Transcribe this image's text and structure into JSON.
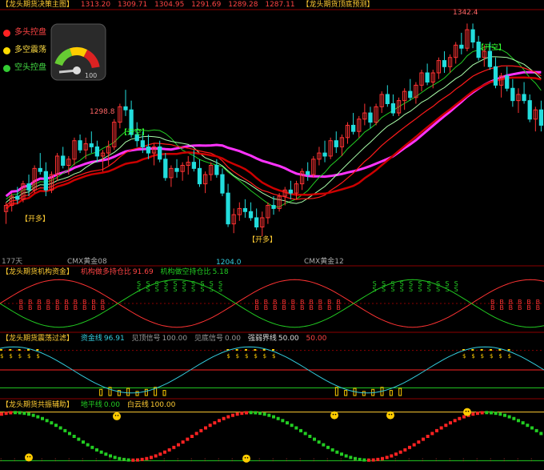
{
  "colors": {
    "up": "#ff3333",
    "down": "#22dddd",
    "ma_red": "#ff1a1a",
    "ma_green": "#22cc22",
    "magenta": "#ff33ff",
    "yellow": "#ffcc00",
    "grid": "#3a0000",
    "gold": "#ffcc33"
  },
  "main": {
    "title": "【龙头期货决策主图】",
    "values": [
      "1313.20",
      "1309.71",
      "1304.95",
      "1291.69",
      "1289.28",
      "1287.11"
    ],
    "right_title": "【龙头期货顶底预测】",
    "legend": [
      {
        "label": "多头控盘",
        "color": "#ff2222"
      },
      {
        "label": "多空震荡",
        "color": "#ffdd00"
      },
      {
        "label": "空头控盘",
        "color": "#33cc33"
      }
    ],
    "gauge_max": "100",
    "annotations": {
      "peak_label": "1298.8",
      "low_label": "1204.0",
      "top_label": "1342.4",
      "kaikong1": "【开空】",
      "kaikong2": "【开空】",
      "kaiduo1": "【开多】",
      "kaiduo2": "【开多】",
      "days": "177天",
      "cmx1": "CMX黄金08",
      "cmx2": "CMX黄金12"
    }
  },
  "panel2": {
    "title": "【龙头期货机构资金】",
    "items": [
      {
        "label": "机构做多持仓比",
        "value": "91.69"
      },
      {
        "label": "机构做空持仓比",
        "value": "5.18"
      }
    ]
  },
  "panel3": {
    "title": "【龙头期货震荡过滤】",
    "items": [
      {
        "label": "资金线",
        "value": "96.91"
      },
      {
        "label": "见顶信号",
        "value": "100.00"
      },
      {
        "label": "见底信号",
        "value": "0.00"
      },
      {
        "label": "强弱界线",
        "value": "50.00"
      },
      {
        "label": "",
        "value": "50.00"
      }
    ]
  },
  "panel4": {
    "title": "【龙头期货共振辅助】",
    "items": [
      {
        "label": "地平线",
        "value": "0.00"
      },
      {
        "label": "白云线",
        "value": "100.00"
      }
    ]
  },
  "chart_data": {
    "type": "candlestick",
    "y_range": [
      1190,
      1350
    ],
    "ohlc": [
      [
        1220,
        1226,
        1212,
        1224
      ],
      [
        1224,
        1232,
        1220,
        1230
      ],
      [
        1230,
        1236,
        1225,
        1228
      ],
      [
        1228,
        1240,
        1226,
        1238
      ],
      [
        1238,
        1244,
        1230,
        1234
      ],
      [
        1234,
        1250,
        1232,
        1248
      ],
      [
        1248,
        1258,
        1244,
        1246
      ],
      [
        1246,
        1252,
        1230,
        1234
      ],
      [
        1234,
        1246,
        1232,
        1244
      ],
      [
        1244,
        1258,
        1240,
        1256
      ],
      [
        1256,
        1262,
        1248,
        1250
      ],
      [
        1250,
        1256,
        1244,
        1254
      ],
      [
        1254,
        1268,
        1250,
        1266
      ],
      [
        1266,
        1270,
        1258,
        1260
      ],
      [
        1260,
        1268,
        1254,
        1264
      ],
      [
        1264,
        1272,
        1258,
        1262
      ],
      [
        1262,
        1266,
        1252,
        1256
      ],
      [
        1256,
        1260,
        1246,
        1258
      ],
      [
        1258,
        1266,
        1250,
        1262
      ],
      [
        1262,
        1280,
        1260,
        1278
      ],
      [
        1278,
        1290,
        1274,
        1288
      ],
      [
        1288,
        1299,
        1282,
        1286
      ],
      [
        1286,
        1292,
        1268,
        1270
      ],
      [
        1270,
        1278,
        1262,
        1266
      ],
      [
        1266,
        1272,
        1258,
        1262
      ],
      [
        1262,
        1270,
        1254,
        1258
      ],
      [
        1258,
        1264,
        1250,
        1262
      ],
      [
        1262,
        1266,
        1252,
        1254
      ],
      [
        1254,
        1258,
        1240,
        1242
      ],
      [
        1242,
        1250,
        1236,
        1248
      ],
      [
        1248,
        1254,
        1242,
        1246
      ],
      [
        1246,
        1252,
        1240,
        1250
      ],
      [
        1250,
        1256,
        1244,
        1252
      ],
      [
        1252,
        1260,
        1246,
        1248
      ],
      [
        1248,
        1254,
        1236,
        1238
      ],
      [
        1238,
        1246,
        1232,
        1244
      ],
      [
        1244,
        1252,
        1240,
        1250
      ],
      [
        1250,
        1254,
        1242,
        1244
      ],
      [
        1244,
        1248,
        1230,
        1232
      ],
      [
        1232,
        1238,
        1210,
        1212
      ],
      [
        1212,
        1222,
        1206,
        1218
      ],
      [
        1218,
        1226,
        1214,
        1222
      ],
      [
        1222,
        1228,
        1216,
        1220
      ],
      [
        1220,
        1226,
        1214,
        1216
      ],
      [
        1216,
        1222,
        1208,
        1210
      ],
      [
        1210,
        1220,
        1204,
        1216
      ],
      [
        1216,
        1226,
        1212,
        1224
      ],
      [
        1224,
        1230,
        1218,
        1222
      ],
      [
        1222,
        1232,
        1220,
        1230
      ],
      [
        1230,
        1236,
        1224,
        1234
      ],
      [
        1234,
        1240,
        1228,
        1232
      ],
      [
        1232,
        1240,
        1228,
        1238
      ],
      [
        1238,
        1248,
        1234,
        1246
      ],
      [
        1246,
        1252,
        1240,
        1244
      ],
      [
        1244,
        1256,
        1242,
        1254
      ],
      [
        1254,
        1262,
        1250,
        1258
      ],
      [
        1258,
        1266,
        1252,
        1256
      ],
      [
        1256,
        1268,
        1254,
        1266
      ],
      [
        1266,
        1272,
        1258,
        1262
      ],
      [
        1262,
        1270,
        1256,
        1268
      ],
      [
        1268,
        1278,
        1264,
        1276
      ],
      [
        1276,
        1284,
        1270,
        1272
      ],
      [
        1272,
        1282,
        1268,
        1280
      ],
      [
        1280,
        1290,
        1276,
        1284
      ],
      [
        1284,
        1288,
        1274,
        1278
      ],
      [
        1278,
        1290,
        1276,
        1288
      ],
      [
        1288,
        1298,
        1284,
        1296
      ],
      [
        1296,
        1302,
        1288,
        1290
      ],
      [
        1290,
        1296,
        1282,
        1284
      ],
      [
        1284,
        1294,
        1282,
        1292
      ],
      [
        1292,
        1300,
        1286,
        1298
      ],
      [
        1298,
        1306,
        1292,
        1294
      ],
      [
        1294,
        1304,
        1290,
        1302
      ],
      [
        1302,
        1312,
        1298,
        1310
      ],
      [
        1310,
        1316,
        1302,
        1304
      ],
      [
        1304,
        1312,
        1300,
        1310
      ],
      [
        1310,
        1320,
        1306,
        1318
      ],
      [
        1318,
        1324,
        1310,
        1314
      ],
      [
        1314,
        1322,
        1310,
        1320
      ],
      [
        1320,
        1330,
        1316,
        1328
      ],
      [
        1328,
        1336,
        1322,
        1326
      ],
      [
        1326,
        1342,
        1324,
        1338
      ],
      [
        1338,
        1342,
        1326,
        1330
      ],
      [
        1330,
        1334,
        1318,
        1320
      ],
      [
        1320,
        1328,
        1314,
        1324
      ],
      [
        1324,
        1330,
        1312,
        1314
      ],
      [
        1314,
        1320,
        1300,
        1302
      ],
      [
        1302,
        1310,
        1294,
        1308
      ],
      [
        1308,
        1314,
        1298,
        1300
      ],
      [
        1300,
        1306,
        1288,
        1292
      ],
      [
        1292,
        1300,
        1284,
        1296
      ],
      [
        1296,
        1304,
        1290,
        1292
      ],
      [
        1292,
        1296,
        1278,
        1280
      ],
      [
        1280,
        1288,
        1272,
        1286
      ],
      [
        1286,
        1292,
        1272,
        1276
      ]
    ]
  }
}
